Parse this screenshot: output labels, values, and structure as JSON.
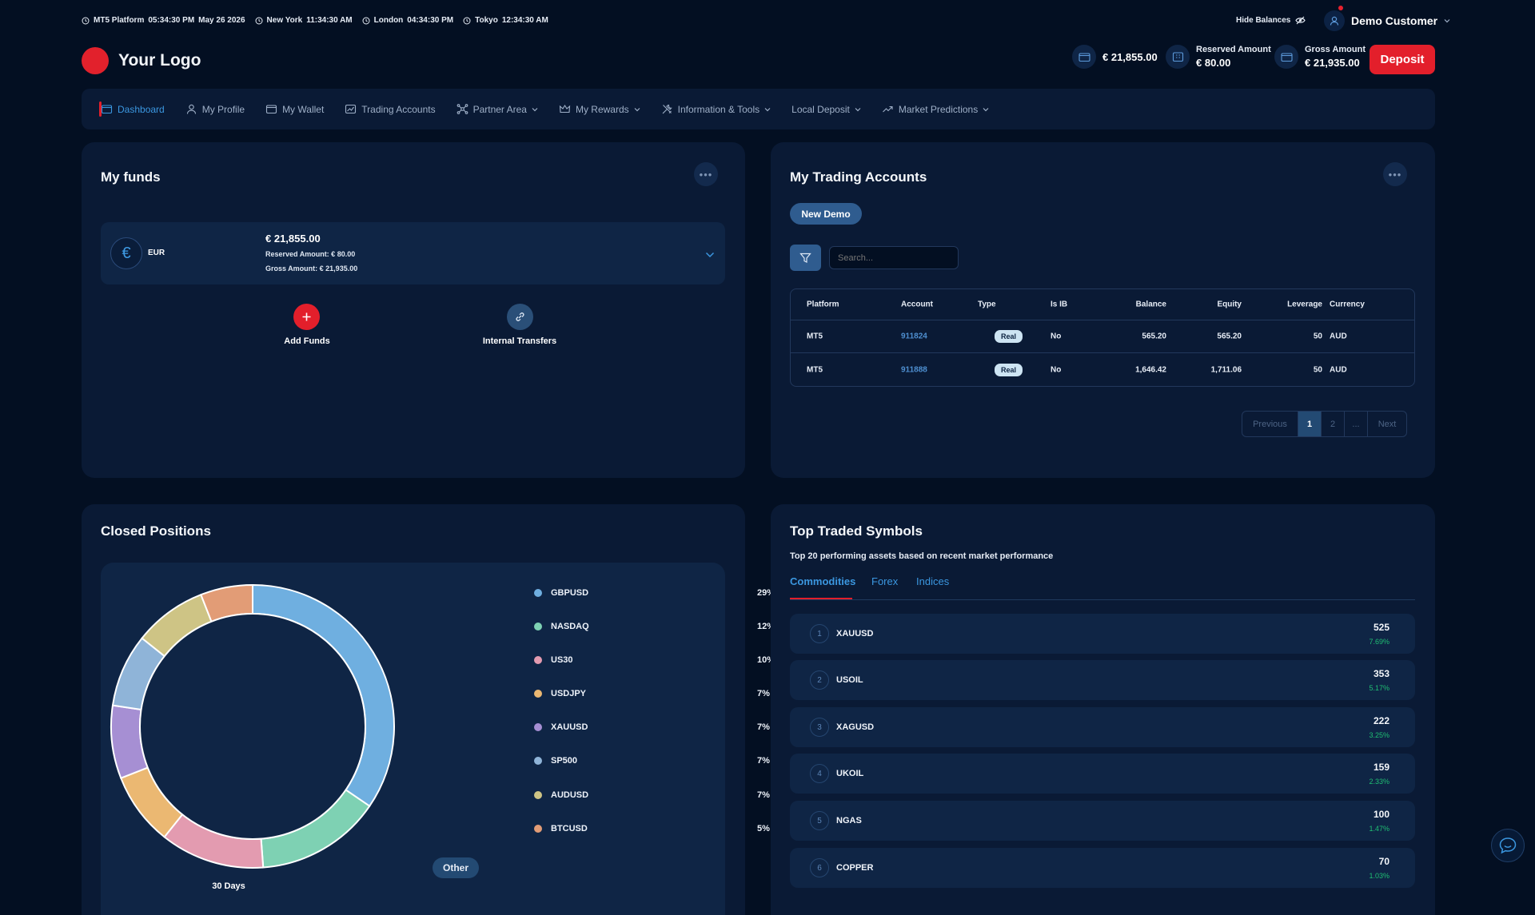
{
  "header": {
    "clocks": [
      {
        "label": "MT5 Platform",
        "time": "05:34:30 PM",
        "date": "May 26 2026"
      },
      {
        "label": "New York",
        "time": "11:34:30 AM"
      },
      {
        "label": "London",
        "time": "04:34:30 PM"
      },
      {
        "label": "Tokyo",
        "time": "12:34:30 AM"
      }
    ],
    "hide_balances": "Hide Balances",
    "user_name": "Demo Customer",
    "logo_text": "Your Logo",
    "balance": "€ 21,855.00",
    "reserved_label": "Reserved Amount",
    "reserved_value": "€ 80.00",
    "gross_label": "Gross Amount",
    "gross_value": "€ 21,935.00",
    "deposit_label": "Deposit"
  },
  "nav": {
    "items": [
      {
        "label": "Dashboard",
        "icon": "wallet-icon",
        "active": true
      },
      {
        "label": "My Profile",
        "icon": "user-icon"
      },
      {
        "label": "My Wallet",
        "icon": "wallet-icon"
      },
      {
        "label": "Trading Accounts",
        "icon": "chart-icon"
      },
      {
        "label": "Partner Area",
        "icon": "network-icon",
        "dropdown": true
      },
      {
        "label": "My Rewards",
        "icon": "crown-icon",
        "dropdown": true
      },
      {
        "label": "Information & Tools",
        "icon": "tools-icon",
        "dropdown": true
      },
      {
        "label": "Local Deposit",
        "dropdown": true
      },
      {
        "label": "Market Predictions",
        "icon": "trend-icon",
        "dropdown": true
      }
    ]
  },
  "funds": {
    "title": "My funds",
    "currency": "EUR",
    "balance": "€ 21,855.00",
    "reserved": "Reserved Amount: € 80.00",
    "gross": "Gross Amount: € 21,935.00",
    "add_funds": "Add Funds",
    "internal_transfers": "Internal Transfers"
  },
  "trading": {
    "title": "My Trading Accounts",
    "new_demo": "New Demo",
    "search_placeholder": "Search...",
    "columns": [
      "Platform",
      "Account",
      "Type",
      "Is IB",
      "Balance",
      "Equity",
      "Leverage",
      "Currency"
    ],
    "rows": [
      {
        "platform": "MT5",
        "account": "911824",
        "type": "Real",
        "is_ib": "No",
        "balance": "565.20",
        "equity": "565.20",
        "leverage": "50",
        "currency": "AUD"
      },
      {
        "platform": "MT5",
        "account": "911888",
        "type": "Real",
        "is_ib": "No",
        "balance": "1,646.42",
        "equity": "1,711.06",
        "leverage": "50",
        "currency": "AUD"
      }
    ],
    "pagination": {
      "previous": "Previous",
      "pages": [
        "1",
        "2",
        "..."
      ],
      "next": "Next",
      "current": "1"
    }
  },
  "closed_positions": {
    "title": "Closed Positions",
    "period": "30 Days",
    "other_label": "Other",
    "legend": [
      {
        "symbol": "GBPUSD",
        "pct": "29%",
        "color": "#6fafe0"
      },
      {
        "symbol": "NASDAQ",
        "pct": "12%",
        "color": "#7ed1b3"
      },
      {
        "symbol": "US30",
        "pct": "10%",
        "color": "#e39bb0"
      },
      {
        "symbol": "USDJPY",
        "pct": "7%",
        "color": "#ebb872"
      },
      {
        "symbol": "XAUUSD",
        "pct": "7%",
        "color": "#a68fd3"
      },
      {
        "symbol": "SP500",
        "pct": "7%",
        "color": "#8fb4d8"
      },
      {
        "symbol": "AUDUSD",
        "pct": "7%",
        "color": "#cec485"
      },
      {
        "symbol": "BTCUSD",
        "pct": "5%",
        "color": "#e29c76"
      }
    ]
  },
  "chart_data": {
    "type": "pie",
    "categories": [
      "GBPUSD",
      "NASDAQ",
      "US30",
      "USDJPY",
      "XAUUSD",
      "SP500",
      "AUDUSD",
      "BTCUSD"
    ],
    "values": [
      29,
      12,
      10,
      7,
      7,
      7,
      7,
      5
    ],
    "donut": true,
    "xlabel": "30 Days"
  },
  "top_symbols": {
    "title": "Top Traded Symbols",
    "subtitle": "Top 20 performing assets based on recent market performance",
    "tabs": [
      "Commodities",
      "Forex",
      "Indices"
    ],
    "active_tab": "Commodities",
    "items": [
      {
        "rank": "1",
        "symbol": "XAUUSD",
        "value": "525",
        "pct": "7.69%"
      },
      {
        "rank": "2",
        "symbol": "USOIL",
        "value": "353",
        "pct": "5.17%"
      },
      {
        "rank": "3",
        "symbol": "XAGUSD",
        "value": "222",
        "pct": "3.25%"
      },
      {
        "rank": "4",
        "symbol": "UKOIL",
        "value": "159",
        "pct": "2.33%"
      },
      {
        "rank": "5",
        "symbol": "NGAS",
        "value": "100",
        "pct": "1.47%"
      },
      {
        "rank": "6",
        "symbol": "COPPER",
        "value": "70",
        "pct": "1.03%"
      }
    ]
  }
}
